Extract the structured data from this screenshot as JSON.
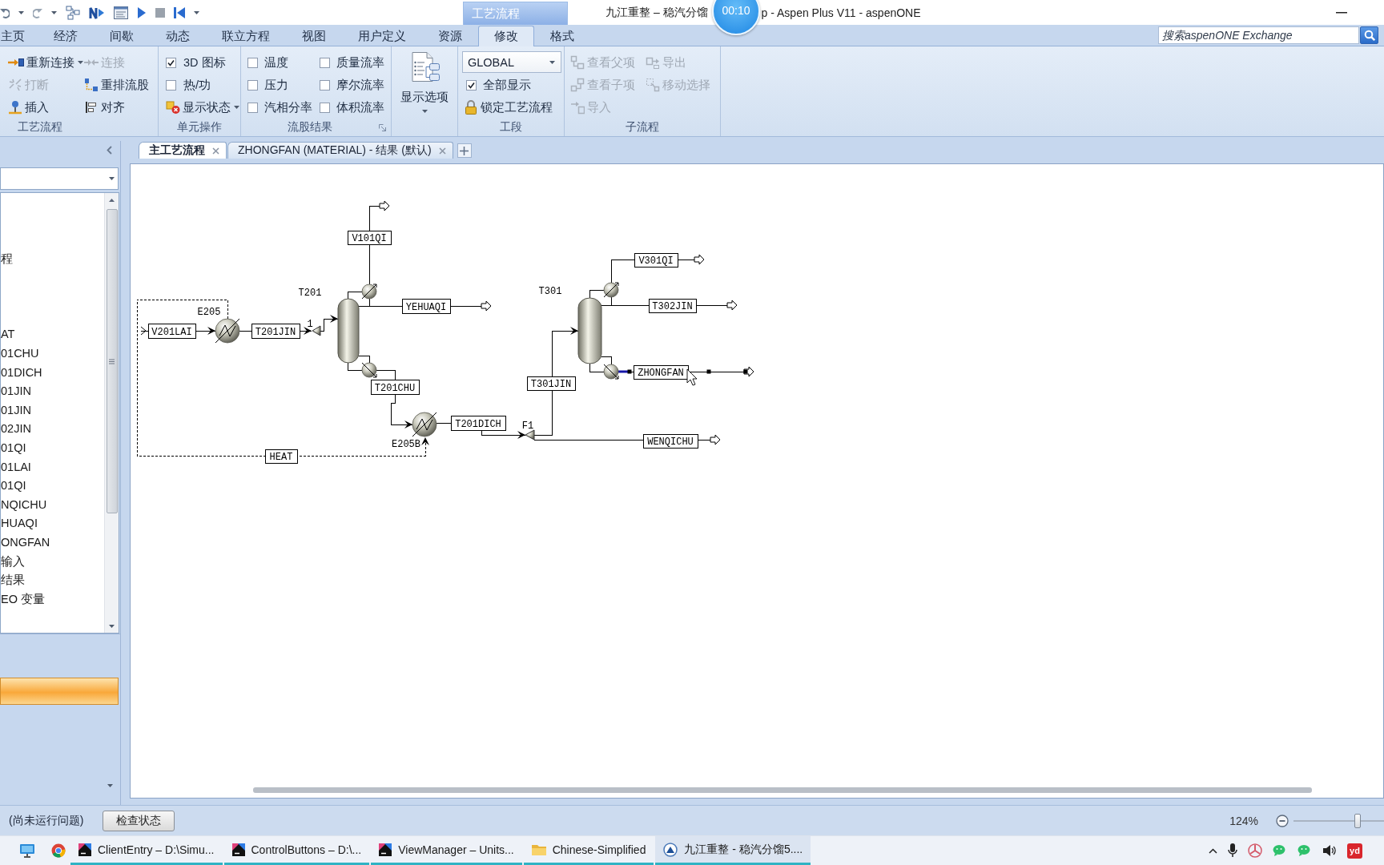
{
  "window": {
    "title": "九江重整 – 稳汽分馏",
    "title_rest": "p - Aspen Plus V11 - aspenONE",
    "context_tab": "工艺流程"
  },
  "recording_timer": "00:10",
  "ribbon": {
    "tabs": [
      {
        "label": "主页",
        "selected": false
      },
      {
        "label": "经济",
        "selected": false
      },
      {
        "label": "间歇",
        "selected": false
      },
      {
        "label": "动态",
        "selected": false
      },
      {
        "label": "联立方程",
        "selected": false
      },
      {
        "label": "视图",
        "selected": false
      },
      {
        "label": "用户定义",
        "selected": false
      },
      {
        "label": "资源",
        "selected": false
      },
      {
        "label": "修改",
        "selected": true
      },
      {
        "label": "格式",
        "selected": false
      }
    ],
    "search": {
      "placeholder": "搜索aspenONE Exchange"
    },
    "groups": [
      {
        "title": "工艺流程",
        "kind": "grid",
        "items": [
          {
            "kind": "command",
            "label": "重新连接",
            "disabled": false,
            "dropdown": true
          },
          {
            "kind": "command",
            "label": "连接",
            "disabled": true,
            "dropdown": false
          },
          {
            "kind": "command",
            "label": "打断",
            "disabled": true,
            "dropdown": false
          },
          {
            "kind": "command",
            "label": "重排流股",
            "disabled": false,
            "dropdown": false
          },
          {
            "kind": "command",
            "label": "插入",
            "disabled": false,
            "dropdown": false
          },
          {
            "kind": "command",
            "label": "对齐",
            "disabled": false,
            "dropdown": false
          }
        ]
      },
      {
        "title": "单元操作",
        "kind": "stack",
        "items": [
          {
            "kind": "checkbox",
            "label": "3D 图标",
            "checked": true
          },
          {
            "kind": "checkbox",
            "label": "热/功",
            "checked": false
          },
          {
            "kind": "command",
            "label": "显示状态",
            "disabled": false,
            "dropdown": true
          }
        ]
      },
      {
        "title": "流股结果",
        "kind": "grid",
        "launcher": true,
        "items": [
          {
            "kind": "checkbox",
            "label": "温度",
            "checked": false
          },
          {
            "kind": "checkbox",
            "label": "质量流率",
            "checked": false
          },
          {
            "kind": "checkbox",
            "label": "压力",
            "checked": false
          },
          {
            "kind": "checkbox",
            "label": "摩尔流率",
            "checked": false
          },
          {
            "kind": "checkbox",
            "label": "汽相分率",
            "checked": false
          },
          {
            "kind": "checkbox",
            "label": "体积流率",
            "checked": false
          }
        ]
      },
      {
        "kind": "large",
        "items": [
          {
            "kind": "command",
            "label": "显示选项",
            "disabled": false,
            "dropdown": true
          }
        ]
      },
      {
        "title": "工段",
        "kind": "stack",
        "items": [
          {
            "kind": "select",
            "value": "GLOBAL"
          },
          {
            "kind": "checkbox",
            "label": "全部显示",
            "checked": true
          },
          {
            "kind": "command",
            "label": "锁定工艺流程",
            "disabled": false,
            "dropdown": false
          }
        ]
      },
      {
        "title": "子流程",
        "kind": "grid",
        "items": [
          {
            "kind": "command",
            "label": "查看父项",
            "disabled": true,
            "dropdown": false
          },
          {
            "kind": "command",
            "label": "导出",
            "disabled": true,
            "dropdown": false
          },
          {
            "kind": "command",
            "label": "查看子项",
            "disabled": true,
            "dropdown": false
          },
          {
            "kind": "command",
            "label": "移动选择",
            "disabled": true,
            "dropdown": false
          },
          {
            "kind": "command",
            "label": "导入",
            "disabled": true,
            "dropdown": false
          }
        ]
      }
    ]
  },
  "document_tabs": [
    {
      "label": "主工艺流程",
      "selected": true
    },
    {
      "label": "ZHONGFAN (MATERIAL) - 结果 (默认)",
      "selected": false
    }
  ],
  "navigation": {
    "tree_items": [
      "程",
      "AT",
      "01CHU",
      "01DICH",
      "01JIN",
      "01JIN",
      "02JIN",
      "01QI",
      "01LAI",
      "01QI",
      "NQICHU",
      "HUAQI",
      "ONGFAN",
      "输入",
      "结果",
      "EO 变量"
    ]
  },
  "flowsheet": {
    "blocks": [
      {
        "label": "T201",
        "kind": "column"
      },
      {
        "label": "T301",
        "kind": "column"
      },
      {
        "label": "E205",
        "kind": "heater"
      },
      {
        "label": "1",
        "kind": "mixer"
      },
      {
        "label": "F1",
        "kind": "splitter"
      },
      {
        "label": "E205B",
        "kind": "heater"
      }
    ],
    "streams": [
      {
        "label": "V101QI",
        "kind": "material",
        "selected": false
      },
      {
        "label": "V301QI",
        "kind": "material",
        "selected": false
      },
      {
        "label": "YEHUAQI",
        "kind": "material",
        "selected": false
      },
      {
        "label": "T302JIN",
        "kind": "material",
        "selected": false
      },
      {
        "label": "V201LAI",
        "kind": "material",
        "selected": false
      },
      {
        "label": "T201JIN",
        "kind": "material",
        "selected": false
      },
      {
        "label": "ZHONGFAN",
        "kind": "material",
        "selected": true
      },
      {
        "label": "T201CHU",
        "kind": "material",
        "selected": false
      },
      {
        "label": "T301JIN",
        "kind": "material",
        "selected": false
      },
      {
        "label": "T201DICH",
        "kind": "material",
        "selected": false
      },
      {
        "label": "WENQICHU",
        "kind": "material",
        "selected": false
      },
      {
        "label": "HEAT",
        "kind": "heat",
        "selected": false
      }
    ]
  },
  "status_bar": {
    "message": "(尚未运行问题)",
    "button": "检查状态",
    "zoom": "124%",
    "zoom_slider": {
      "level": 0.72
    }
  },
  "taskbar": {
    "tasks": [
      {
        "label": "ClientEntry – D:\\Simu...",
        "selected": false
      },
      {
        "label": "ControlButtons – D:\\...",
        "selected": false
      },
      {
        "label": "ViewManager – Units...",
        "selected": false
      },
      {
        "label": "Chinese-Simplified",
        "selected": false
      },
      {
        "label": "九江重整 - 稳汽分馏5....",
        "selected": true
      }
    ],
    "tray_badge": "yd"
  }
}
